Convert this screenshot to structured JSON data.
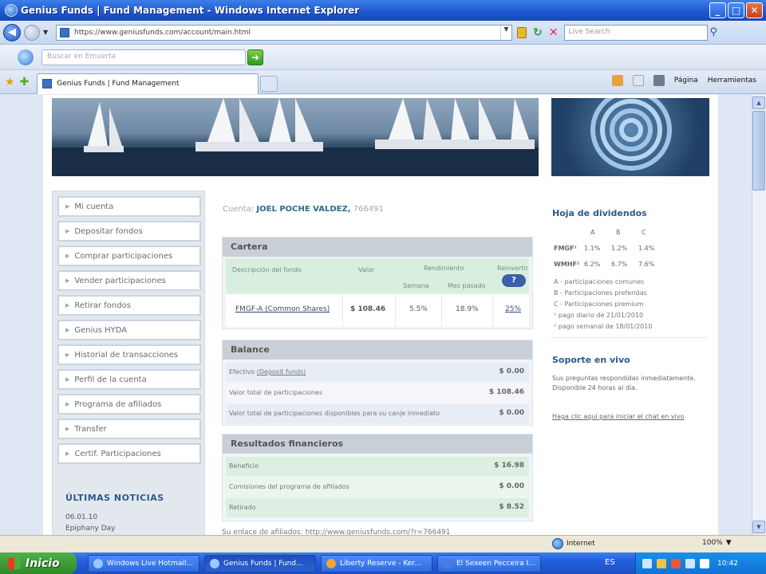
{
  "window": {
    "title": "Genius Funds | Fund Management - Windows Internet Explorer",
    "min": "_",
    "max": "□",
    "close": "✕"
  },
  "address": {
    "url": "https://www.geniusfunds.com/account/main.html",
    "search_placeholder": "Live Search"
  },
  "toolbar": {
    "search_placeholder": "Buscar en Emuerta"
  },
  "tabs": [
    {
      "label": "Genius Funds | Fund Management"
    }
  ],
  "commands": {
    "page": "Página",
    "tools": "Herramientas"
  },
  "sidebar": {
    "items": [
      {
        "label": "Mi cuenta"
      },
      {
        "label": "Depositar fondos"
      },
      {
        "label": "Comprar participaciones"
      },
      {
        "label": "Vender participaciones"
      },
      {
        "label": "Retirar fondos"
      },
      {
        "label": "Genius HYDA"
      },
      {
        "label": "Historial de transacciones"
      },
      {
        "label": "Perfil de la cuenta"
      },
      {
        "label": "Programa de afiliados"
      },
      {
        "label": "Transfer"
      },
      {
        "label": "Certif. Participaciones"
      }
    ],
    "news_title": "ÚLTIMAS NOTICIAS",
    "news_date": "06.01.10",
    "news_text": "Epiphany Day"
  },
  "account": {
    "label": "Cuenta:",
    "name": "JOEL POCHE VALDEZ,",
    "number": "766491"
  },
  "cartera": {
    "title": "Cartera",
    "headers": {
      "desc": "Descripción del fondo",
      "value": "Valor",
      "return": "Rendimiento",
      "week": "Semana",
      "last_month": "Mes pasado",
      "reinvest": "Reinvertir",
      "help": "?"
    },
    "row": {
      "fund": "FMGF-A (Common Shares)",
      "value": "$ 108.46",
      "week": "5.5%",
      "last_month": "18.9%",
      "reinvest": "25%"
    }
  },
  "balance": {
    "title": "Balance",
    "rows": [
      {
        "label": "Efectivo",
        "link": "(Deposit funds)",
        "value": "$ 0.00"
      },
      {
        "label": "Valor total de participaciones",
        "value": "$ 108.46"
      },
      {
        "label": "Valor total de participaciones disponibles para su canje inmediato",
        "value": "$ 0.00"
      }
    ]
  },
  "resultados": {
    "title": "Resultados financieros",
    "rows": [
      {
        "label": "Beneficio",
        "value": "$ 16.98"
      },
      {
        "label": "Comisiones del programa de afiliados",
        "value": "$ 0.00"
      },
      {
        "label": "Retirado",
        "value": "$ 8.52"
      }
    ]
  },
  "referral": "Su enlace de afiliados: http://www.geniusfunds.com/?r=766491",
  "dividends": {
    "title": "Hoja de dividendos",
    "cols": [
      "A",
      "B",
      "C"
    ],
    "rows": [
      {
        "fund": "FMGF¹",
        "a": "1.1%",
        "b": "1.2%",
        "c": "1.4%"
      },
      {
        "fund": "WMHF²",
        "a": "6.2%",
        "b": "6.7%",
        "c": "7.6%"
      }
    ],
    "legend": [
      "A - participaciones comunes",
      "B - Participaciones preferidas",
      "C - Participaciones premium",
      "¹ pago diario de 21/01/2010",
      "² pago semanal de 18/01/2010"
    ]
  },
  "support": {
    "title": "Soporte en vivo",
    "text": "Sus preguntas respondidas inmediatamente. Disponible 24 horas al día.",
    "link": "Haga clic aquí para iniciar el chat en vivo"
  },
  "status": {
    "zone": "Internet",
    "zoom": "100%"
  },
  "taskbar": {
    "start": "Inicio",
    "items": [
      "Windows Live Hotmail...",
      "Genius Funds | Fund...",
      "Liberty Reserve - Ker...",
      "El Sexeen Pecceira I..."
    ],
    "lang": "ES",
    "time": "10:42"
  }
}
